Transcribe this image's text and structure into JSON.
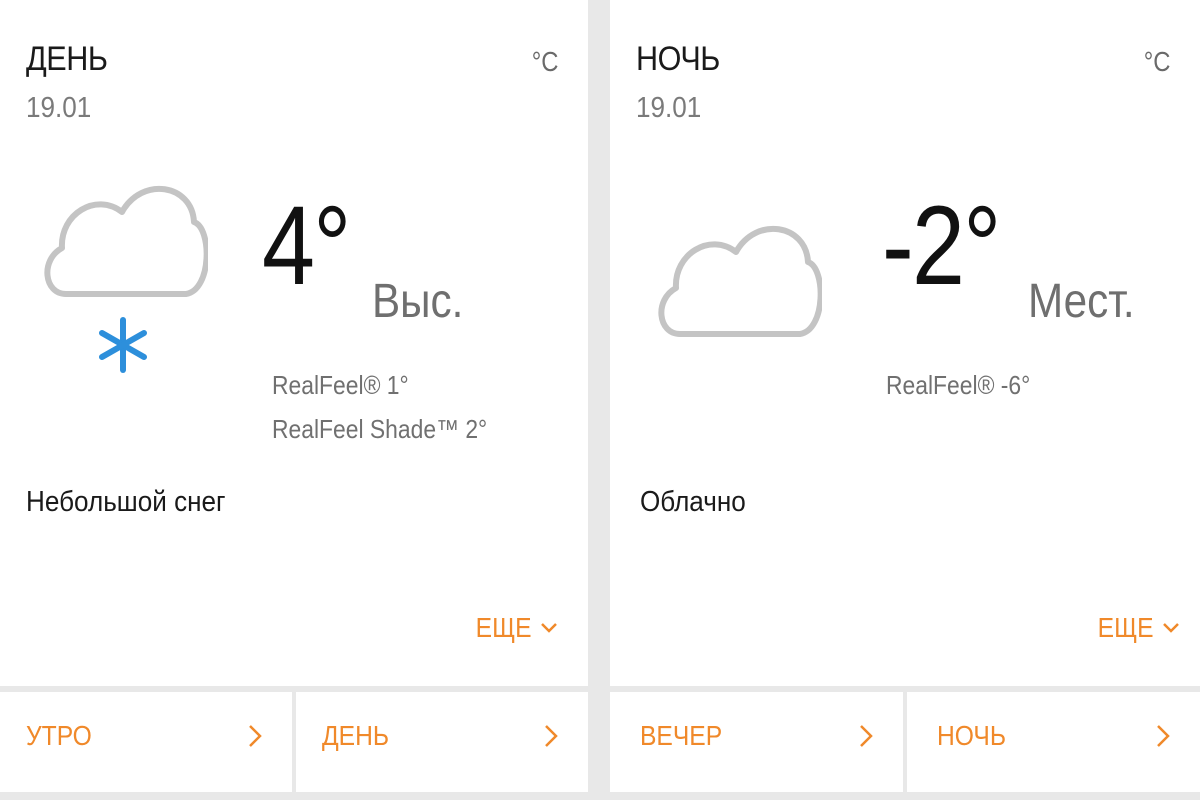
{
  "accent_color": "#f0892a",
  "snow_color": "#2d8fdb",
  "day": {
    "title": "ДЕНЬ",
    "date": "19.01",
    "unit": "°C",
    "icon": "cloud-snow-icon",
    "temperature": "4°",
    "temp_label": "Выс.",
    "realfeel": "RealFeel® 1°",
    "realfeel_shade": "RealFeel Shade™ 2°",
    "phrase": "Небольшой снег",
    "more_label": "ЕЩЕ",
    "tabs": [
      {
        "label": "УТРО"
      },
      {
        "label": "ДЕНЬ"
      }
    ]
  },
  "night": {
    "title": "НОЧЬ",
    "date": "19.01",
    "unit": "°C",
    "icon": "cloud-icon",
    "temperature": "-2°",
    "temp_label": "Мест.",
    "realfeel": "RealFeel® -6°",
    "phrase": "Облачно",
    "more_label": "ЕЩЕ",
    "tabs": [
      {
        "label": "ВЕЧЕР"
      },
      {
        "label": "НОЧЬ"
      }
    ]
  }
}
